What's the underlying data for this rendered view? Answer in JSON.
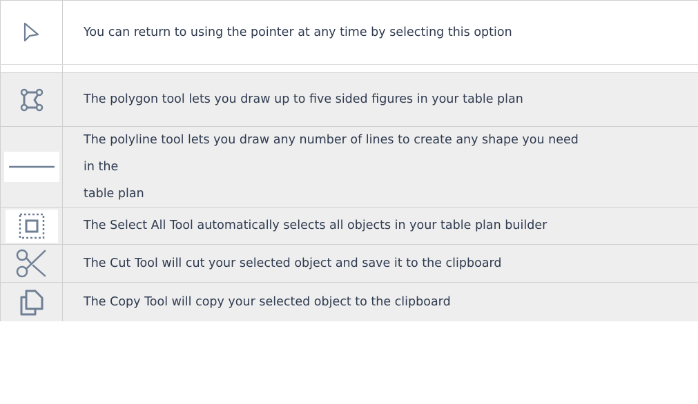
{
  "tools": [
    {
      "icon": "pointer-icon",
      "text": "You can return to using the pointer at any time by selecting this option"
    },
    {
      "icon": "polygon-icon",
      "text": "The polygon tool lets you draw up to five sided figures in your table plan"
    },
    {
      "icon": "polyline-icon",
      "lines": [
        "The polyline tool lets you draw any number of lines to create any shape you need",
        "in the",
        "table plan"
      ]
    },
    {
      "icon": "select-all-icon",
      "text": "The Select All Tool automatically selects all objects in your table plan builder"
    },
    {
      "icon": "scissors-icon",
      "text": "The Cut Tool will cut your selected object and save it to the clipboard"
    },
    {
      "icon": "copy-icon",
      "text": "The Copy Tool will copy your selected object to the clipboard"
    }
  ],
  "colors": {
    "text": "#2e3a4f",
    "icon": "#6f7f95",
    "row_shade": "#eeeeee",
    "border": "#cfcfcf"
  }
}
